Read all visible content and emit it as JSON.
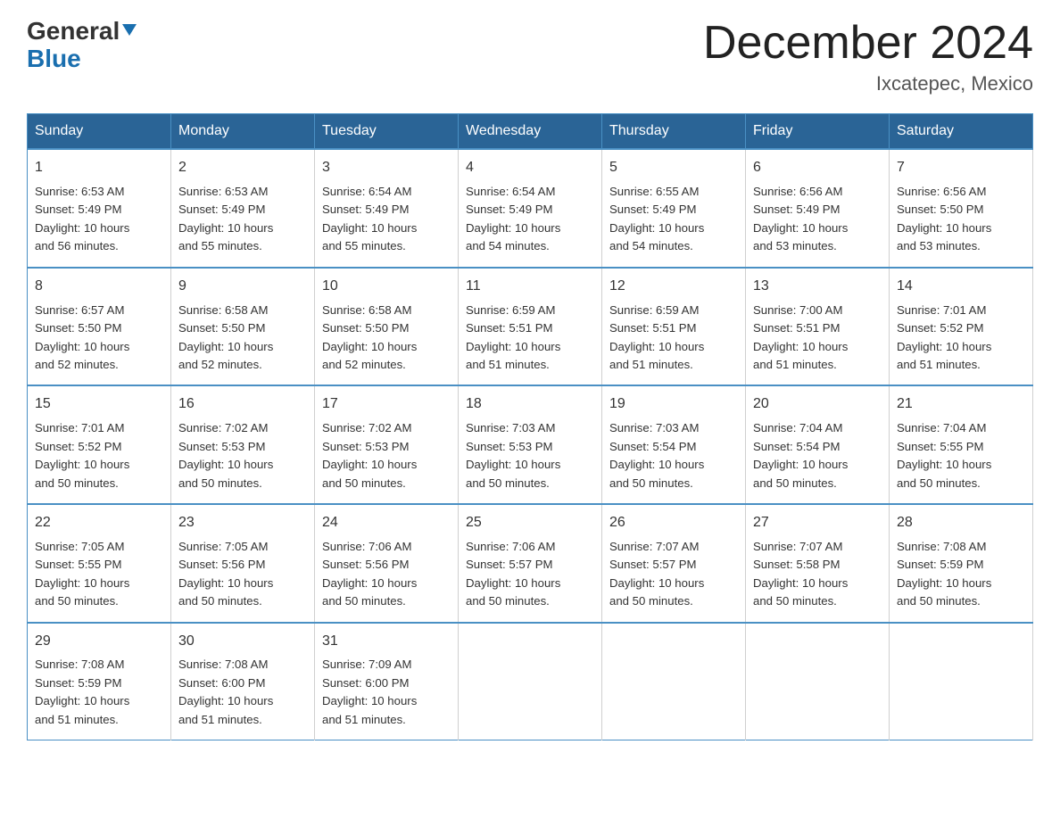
{
  "header": {
    "logo_general": "General",
    "logo_blue": "Blue",
    "month_title": "December 2024",
    "location": "Ixcatepec, Mexico"
  },
  "days_of_week": [
    "Sunday",
    "Monday",
    "Tuesday",
    "Wednesday",
    "Thursday",
    "Friday",
    "Saturday"
  ],
  "weeks": [
    [
      {
        "day": "1",
        "sunrise": "6:53 AM",
        "sunset": "5:49 PM",
        "daylight": "10 hours and 56 minutes."
      },
      {
        "day": "2",
        "sunrise": "6:53 AM",
        "sunset": "5:49 PM",
        "daylight": "10 hours and 55 minutes."
      },
      {
        "day": "3",
        "sunrise": "6:54 AM",
        "sunset": "5:49 PM",
        "daylight": "10 hours and 55 minutes."
      },
      {
        "day": "4",
        "sunrise": "6:54 AM",
        "sunset": "5:49 PM",
        "daylight": "10 hours and 54 minutes."
      },
      {
        "day": "5",
        "sunrise": "6:55 AM",
        "sunset": "5:49 PM",
        "daylight": "10 hours and 54 minutes."
      },
      {
        "day": "6",
        "sunrise": "6:56 AM",
        "sunset": "5:49 PM",
        "daylight": "10 hours and 53 minutes."
      },
      {
        "day": "7",
        "sunrise": "6:56 AM",
        "sunset": "5:50 PM",
        "daylight": "10 hours and 53 minutes."
      }
    ],
    [
      {
        "day": "8",
        "sunrise": "6:57 AM",
        "sunset": "5:50 PM",
        "daylight": "10 hours and 52 minutes."
      },
      {
        "day": "9",
        "sunrise": "6:58 AM",
        "sunset": "5:50 PM",
        "daylight": "10 hours and 52 minutes."
      },
      {
        "day": "10",
        "sunrise": "6:58 AM",
        "sunset": "5:50 PM",
        "daylight": "10 hours and 52 minutes."
      },
      {
        "day": "11",
        "sunrise": "6:59 AM",
        "sunset": "5:51 PM",
        "daylight": "10 hours and 51 minutes."
      },
      {
        "day": "12",
        "sunrise": "6:59 AM",
        "sunset": "5:51 PM",
        "daylight": "10 hours and 51 minutes."
      },
      {
        "day": "13",
        "sunrise": "7:00 AM",
        "sunset": "5:51 PM",
        "daylight": "10 hours and 51 minutes."
      },
      {
        "day": "14",
        "sunrise": "7:01 AM",
        "sunset": "5:52 PM",
        "daylight": "10 hours and 51 minutes."
      }
    ],
    [
      {
        "day": "15",
        "sunrise": "7:01 AM",
        "sunset": "5:52 PM",
        "daylight": "10 hours and 50 minutes."
      },
      {
        "day": "16",
        "sunrise": "7:02 AM",
        "sunset": "5:53 PM",
        "daylight": "10 hours and 50 minutes."
      },
      {
        "day": "17",
        "sunrise": "7:02 AM",
        "sunset": "5:53 PM",
        "daylight": "10 hours and 50 minutes."
      },
      {
        "day": "18",
        "sunrise": "7:03 AM",
        "sunset": "5:53 PM",
        "daylight": "10 hours and 50 minutes."
      },
      {
        "day": "19",
        "sunrise": "7:03 AM",
        "sunset": "5:54 PM",
        "daylight": "10 hours and 50 minutes."
      },
      {
        "day": "20",
        "sunrise": "7:04 AM",
        "sunset": "5:54 PM",
        "daylight": "10 hours and 50 minutes."
      },
      {
        "day": "21",
        "sunrise": "7:04 AM",
        "sunset": "5:55 PM",
        "daylight": "10 hours and 50 minutes."
      }
    ],
    [
      {
        "day": "22",
        "sunrise": "7:05 AM",
        "sunset": "5:55 PM",
        "daylight": "10 hours and 50 minutes."
      },
      {
        "day": "23",
        "sunrise": "7:05 AM",
        "sunset": "5:56 PM",
        "daylight": "10 hours and 50 minutes."
      },
      {
        "day": "24",
        "sunrise": "7:06 AM",
        "sunset": "5:56 PM",
        "daylight": "10 hours and 50 minutes."
      },
      {
        "day": "25",
        "sunrise": "7:06 AM",
        "sunset": "5:57 PM",
        "daylight": "10 hours and 50 minutes."
      },
      {
        "day": "26",
        "sunrise": "7:07 AM",
        "sunset": "5:57 PM",
        "daylight": "10 hours and 50 minutes."
      },
      {
        "day": "27",
        "sunrise": "7:07 AM",
        "sunset": "5:58 PM",
        "daylight": "10 hours and 50 minutes."
      },
      {
        "day": "28",
        "sunrise": "7:08 AM",
        "sunset": "5:59 PM",
        "daylight": "10 hours and 50 minutes."
      }
    ],
    [
      {
        "day": "29",
        "sunrise": "7:08 AM",
        "sunset": "5:59 PM",
        "daylight": "10 hours and 51 minutes."
      },
      {
        "day": "30",
        "sunrise": "7:08 AM",
        "sunset": "6:00 PM",
        "daylight": "10 hours and 51 minutes."
      },
      {
        "day": "31",
        "sunrise": "7:09 AM",
        "sunset": "6:00 PM",
        "daylight": "10 hours and 51 minutes."
      },
      null,
      null,
      null,
      null
    ]
  ],
  "labels": {
    "sunrise": "Sunrise:",
    "sunset": "Sunset:",
    "daylight": "Daylight:"
  }
}
